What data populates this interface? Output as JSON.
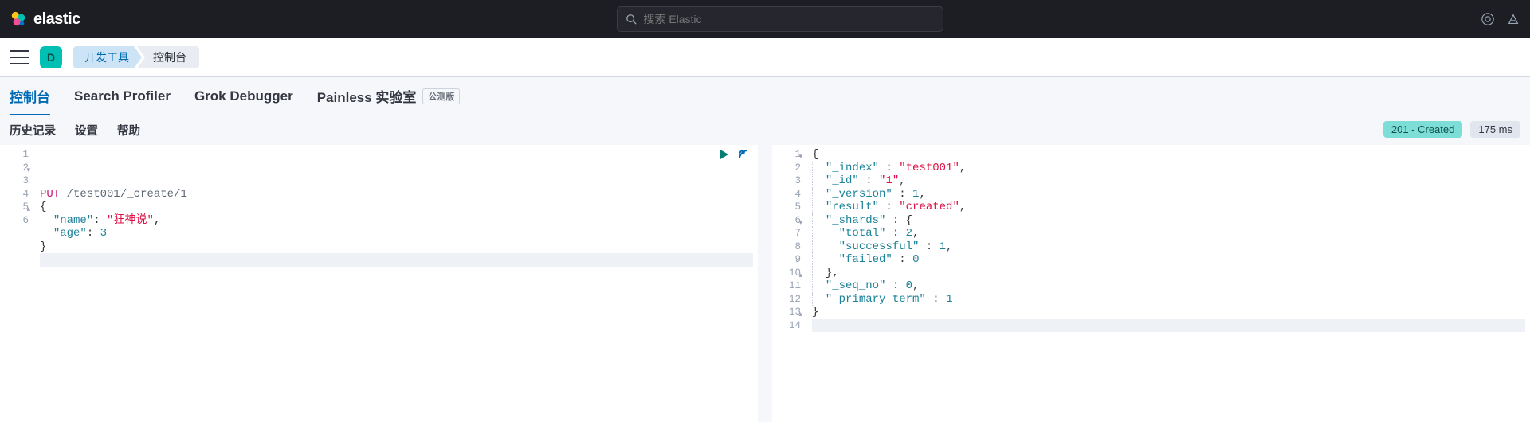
{
  "brand": {
    "name": "elastic"
  },
  "search": {
    "placeholder": "搜索 Elastic"
  },
  "space_initial": "D",
  "breadcrumbs": {
    "dev_tools": "开发工具",
    "console": "控制台"
  },
  "tabs": {
    "console": "控制台",
    "search_profiler": "Search Profiler",
    "grok_debugger": "Grok Debugger",
    "painless_lab": "Painless 实验室",
    "beta_label": "公测版"
  },
  "subtabs": {
    "history": "历史记录",
    "settings": "设置",
    "help": "帮助"
  },
  "status": {
    "code": "201 - Created",
    "time": "175 ms"
  },
  "request": {
    "method": "PUT",
    "path": "/test001/_create/1",
    "lines": [
      {
        "n": 1,
        "method": "PUT",
        "path": "/test001/_create/1"
      },
      {
        "n": 2,
        "fold": "▾",
        "raw_open": "{"
      },
      {
        "n": 3,
        "key": "\"name\"",
        "sep": ": ",
        "val_str": "\"狂神说\"",
        "trail": ",",
        "indent": 1
      },
      {
        "n": 4,
        "key": "\"age\"",
        "sep": ": ",
        "val_num": "3",
        "indent": 1
      },
      {
        "n": 5,
        "fold": "▴",
        "raw_close": "}"
      },
      {
        "n": 6,
        "cursor": true
      }
    ]
  },
  "response": {
    "lines": [
      {
        "n": 1,
        "fold": "▾",
        "tokens": [
          {
            "p": "{"
          }
        ]
      },
      {
        "n": 2,
        "indent": 1,
        "tokens": [
          {
            "k": "\"_index\""
          },
          {
            "p": " : "
          },
          {
            "s": "\"test001\""
          },
          {
            "p": ","
          }
        ]
      },
      {
        "n": 3,
        "indent": 1,
        "tokens": [
          {
            "k": "\"_id\""
          },
          {
            "p": " : "
          },
          {
            "s": "\"1\""
          },
          {
            "p": ","
          }
        ]
      },
      {
        "n": 4,
        "indent": 1,
        "tokens": [
          {
            "k": "\"_version\""
          },
          {
            "p": " : "
          },
          {
            "num": "1"
          },
          {
            "p": ","
          }
        ]
      },
      {
        "n": 5,
        "indent": 1,
        "tokens": [
          {
            "k": "\"result\""
          },
          {
            "p": " : "
          },
          {
            "s": "\"created\""
          },
          {
            "p": ","
          }
        ]
      },
      {
        "n": 6,
        "fold": "▾",
        "indent": 1,
        "tokens": [
          {
            "k": "\"_shards\""
          },
          {
            "p": " : "
          },
          {
            "p": "{"
          }
        ]
      },
      {
        "n": 7,
        "indent": 2,
        "tokens": [
          {
            "k": "\"total\""
          },
          {
            "p": " : "
          },
          {
            "num": "2"
          },
          {
            "p": ","
          }
        ]
      },
      {
        "n": 8,
        "indent": 2,
        "tokens": [
          {
            "k": "\"successful\""
          },
          {
            "p": " : "
          },
          {
            "num": "1"
          },
          {
            "p": ","
          }
        ]
      },
      {
        "n": 9,
        "indent": 2,
        "tokens": [
          {
            "k": "\"failed\""
          },
          {
            "p": " : "
          },
          {
            "num": "0"
          }
        ]
      },
      {
        "n": 10,
        "fold": "▴",
        "indent": 1,
        "tokens": [
          {
            "p": "},"
          }
        ]
      },
      {
        "n": 11,
        "indent": 1,
        "tokens": [
          {
            "k": "\"_seq_no\""
          },
          {
            "p": " : "
          },
          {
            "num": "0"
          },
          {
            "p": ","
          }
        ]
      },
      {
        "n": 12,
        "indent": 1,
        "tokens": [
          {
            "k": "\"_primary_term\""
          },
          {
            "p": " : "
          },
          {
            "num": "1"
          }
        ]
      },
      {
        "n": 13,
        "fold": "▴",
        "tokens": [
          {
            "p": "}"
          }
        ]
      },
      {
        "n": 14,
        "cursor": true
      }
    ]
  }
}
